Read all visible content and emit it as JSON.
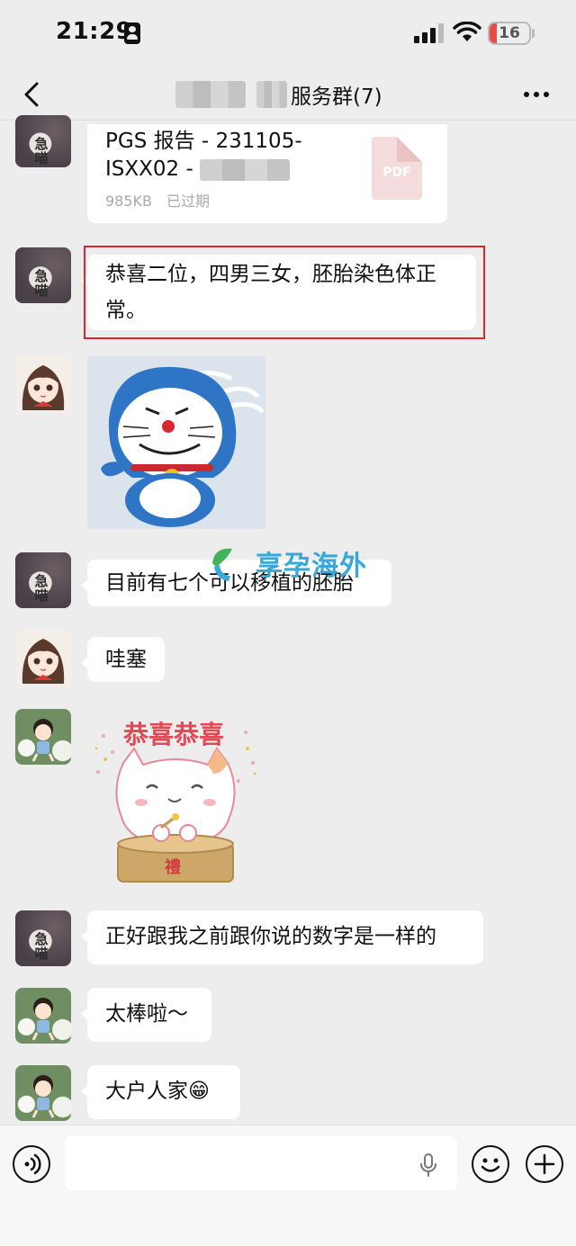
{
  "status_bar": {
    "time": "21:29",
    "battery_level": "16",
    "battery_color": "#e84b48"
  },
  "header": {
    "title": "服务群(7)",
    "back_icon": "chevron-left-icon",
    "more_icon": "ellipsis-icon"
  },
  "messages": [
    {
      "type": "file",
      "sender": "user-a",
      "file_name": "PGS 报告 - 231105-ISXX02 -",
      "file_size": "985KB",
      "file_status": "已过期",
      "file_type": "PDF"
    },
    {
      "type": "text",
      "sender": "user-a",
      "text": "恭喜二位，四男三女，胚胎染色体正常。",
      "highlighted": true
    },
    {
      "type": "sticker",
      "sender": "user-b",
      "sticker": "doraemon-angry"
    },
    {
      "type": "text",
      "sender": "user-a",
      "text": "目前有七个可以移植的胚胎"
    },
    {
      "type": "text",
      "sender": "user-b",
      "text": "哇塞"
    },
    {
      "type": "sticker",
      "sender": "user-c",
      "sticker_text": "恭喜恭喜",
      "sticker_subtext": "禮"
    },
    {
      "type": "text",
      "sender": "user-a",
      "text": "正好跟我之前跟你说的数字是一样的"
    },
    {
      "type": "text",
      "sender": "user-c",
      "text": "太棒啦～"
    },
    {
      "type": "text",
      "sender": "user-c",
      "text": "大户人家😁"
    }
  ],
  "avatar_a_text": "急喵",
  "watermark": "享孕海外",
  "highlight_color": "#e0252b",
  "input_bar": {
    "voice_icon": "voice-icon",
    "mic_icon": "microphone-icon",
    "emoji_icon": "emoji-icon",
    "add_icon": "plus-icon"
  }
}
